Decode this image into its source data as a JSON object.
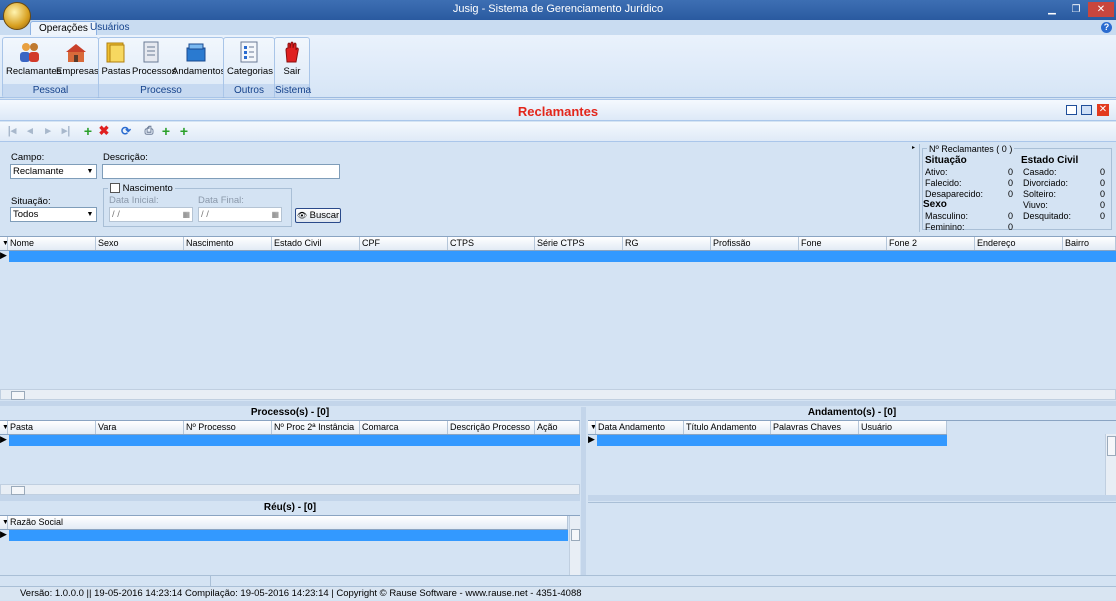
{
  "window": {
    "title": "Jusig - Sistema de Gerenciamento Jurídico"
  },
  "tabs": [
    {
      "label": "Operações",
      "active": true
    },
    {
      "label": "Usuários",
      "active": false
    }
  ],
  "ribbon": {
    "groups": [
      {
        "label": "Pessoal",
        "buttons": [
          "Reclamantes",
          "Empresas"
        ]
      },
      {
        "label": "Processo",
        "buttons": [
          "Pastas",
          "Processos",
          "Andamentos"
        ]
      },
      {
        "label": "Outros",
        "buttons": [
          "Categorias"
        ]
      },
      {
        "label": "Sistema",
        "buttons": [
          "Sair"
        ]
      }
    ]
  },
  "panel": {
    "title": "Reclamantes"
  },
  "filter": {
    "campo_label": "Campo:",
    "campo_value": "Reclamante",
    "descricao_label": "Descrição:",
    "descricao_value": "",
    "situacao_label": "Situação:",
    "situacao_value": "Todos",
    "nascimento_label": "Nascimento",
    "data_inicial_label": "Data Inicial:",
    "data_inicial_value": " / /",
    "data_final_label": "Data Final:",
    "data_final_value": " / /",
    "buscar_label": "Buscar"
  },
  "stats": {
    "title": "Nº Reclamantes ( 0 )",
    "situacao_header": "Situação",
    "estado_civil_header": "Estado Civil",
    "sexo_header": "Sexo",
    "situacao": [
      {
        "label": "Ativo:",
        "value": "0"
      },
      {
        "label": "Falecido:",
        "value": "0"
      },
      {
        "label": "Desaparecido:",
        "value": "0"
      }
    ],
    "estado_civil": [
      {
        "label": "Casado:",
        "value": "0"
      },
      {
        "label": "Divorciado:",
        "value": "0"
      },
      {
        "label": "Solteiro:",
        "value": "0"
      },
      {
        "label": "Viuvo:",
        "value": "0"
      },
      {
        "label": "Desquitado:",
        "value": "0"
      }
    ],
    "sexo": [
      {
        "label": "Masculino:",
        "value": "0"
      },
      {
        "label": "Feminino:",
        "value": "0"
      }
    ]
  },
  "main_grid": {
    "columns": [
      "Nome",
      "Sexo",
      "Nascimento",
      "Estado Civil",
      "CPF",
      "CTPS",
      "Série CTPS",
      "RG",
      "Profissão",
      "Fone",
      "Fone 2",
      "Endereço",
      "Bairro"
    ]
  },
  "processos": {
    "title": "Processo(s) - [0]",
    "columns": [
      "Pasta",
      "Vara",
      "Nº Processo",
      "Nº Proc 2ª Instância",
      "Comarca",
      "Descrição Processo",
      "Ação"
    ]
  },
  "andamentos": {
    "title": "Andamento(s) - [0]",
    "columns": [
      "Data Andamento",
      "Título Andamento",
      "Palavras Chaves",
      "Usuário"
    ]
  },
  "reus": {
    "title": "Réu(s) - [0]",
    "columns": [
      "Razão Social"
    ]
  },
  "statusbar": {
    "text": "Versão: 1.0.0.0 || 19-05-2016 14:23:14  Compilação: 19-05-2016 14:23:14 | Copyright © Rause Software  -  www.rause.net  -  4351-4088"
  }
}
